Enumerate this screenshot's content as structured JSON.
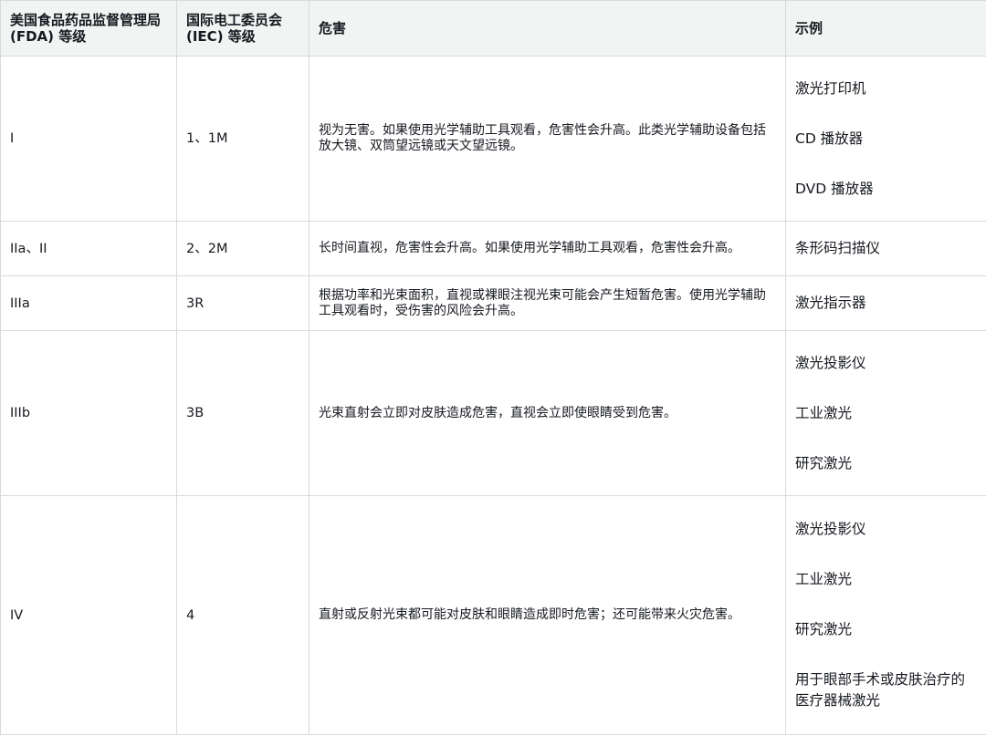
{
  "table": {
    "headers": [
      "美国食品药品监督管理局 (FDA) 等级",
      "国际电工委员会 (IEC) 等级",
      "危害",
      "示例"
    ],
    "rows": [
      {
        "fda": "I",
        "iec": "1、1M",
        "hazard": "视为无害。如果使用光学辅助工具观看，危害性会升高。此类光学辅助设备包括放大镜、双筒望远镜或天文望远镜。",
        "examples": [
          "激光打印机",
          "CD 播放器",
          "DVD 播放器"
        ]
      },
      {
        "fda": "IIa、II",
        "iec": "2、2M",
        "hazard": "长时间直视，危害性会升高。如果使用光学辅助工具观看，危害性会升高。",
        "examples": [
          "条形码扫描仪"
        ]
      },
      {
        "fda": "IIIa",
        "iec": "3R",
        "hazard": "根据功率和光束面积，直视或裸眼注视光束可能会产生短暂危害。使用光学辅助工具观看时，受伤害的风险会升高。",
        "examples": [
          "激光指示器"
        ]
      },
      {
        "fda": "IIIb",
        "iec": "3B",
        "hazard": "光束直射会立即对皮肤造成危害，直视会立即使眼睛受到危害。",
        "examples": [
          "激光投影仪",
          "工业激光",
          "研究激光"
        ]
      },
      {
        "fda": "IV",
        "iec": "4",
        "hazard": "直射或反射光束都可能对皮肤和眼睛造成即时危害；还可能带来火灾危害。",
        "examples": [
          "激光投影仪",
          "工业激光",
          "研究激光",
          "用于眼部手术或皮肤治疗的医疗器械激光"
        ]
      }
    ]
  }
}
